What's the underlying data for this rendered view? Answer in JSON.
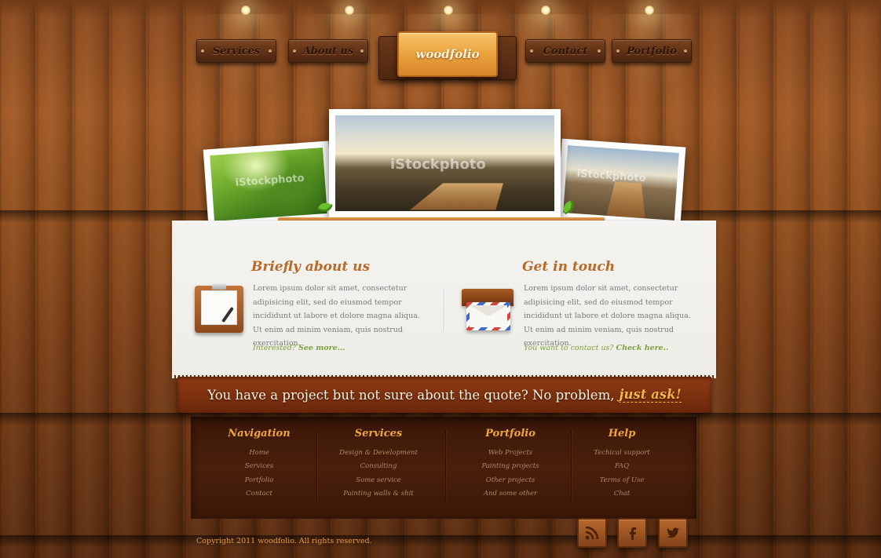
{
  "nav": {
    "items": [
      {
        "label": "Services"
      },
      {
        "label": "About us"
      },
      {
        "label": "Contact"
      },
      {
        "label": "Portfolio"
      }
    ],
    "logo": "woodfolio"
  },
  "photos": {
    "watermark": "iStockphoto"
  },
  "about": {
    "title": "Briefly about us",
    "text": "Lorem ipsum dolor sit amet, consectetur adipisicing elit, sed do eiusmod tempor incididunt ut labore et dolore magna aliqua. Ut enim ad minim veniam, quis nostrud exercitation.",
    "link_prefix": "Interested?",
    "link_label": "See more..."
  },
  "contact": {
    "title": "Get in touch",
    "text": "Lorem ipsum dolor sit amet, consectetur adipisicing elit, sed do eiusmod tempor incididunt ut labore et dolore magna aliqua. Ut enim ad minim veniam, quis nostrud exercitation.",
    "link_prefix": "You want to contact us?",
    "link_label": "Check here.."
  },
  "banner": {
    "text": "You have a project but not sure about the quote? No problem,",
    "ask": "just ask!"
  },
  "footer": {
    "columns": [
      {
        "heading": "Navigation",
        "items": [
          "Home",
          "Services",
          "Portfolio",
          "Contact"
        ]
      },
      {
        "heading": "Services",
        "items": [
          "Design & Development",
          "Consulting",
          "Some service",
          "Painting walls & shit"
        ]
      },
      {
        "heading": "Portfolio",
        "items": [
          "Web Projects",
          "Painting projects",
          "Other projects",
          "And some other"
        ]
      },
      {
        "heading": "Help",
        "items": [
          "Techical support",
          "FAQ",
          "Terms of Use",
          "Chat"
        ]
      }
    ],
    "copyright": "Copyright 2011 woodfolio. All rights reserved.",
    "social": [
      "rss-icon",
      "facebook-icon",
      "twitter-icon"
    ]
  },
  "colors": {
    "accent_orange": "#b86a28",
    "link_green": "#7ea23a",
    "footer_heading": "#f0a53e",
    "banner_bg": "#7a2f0e"
  }
}
